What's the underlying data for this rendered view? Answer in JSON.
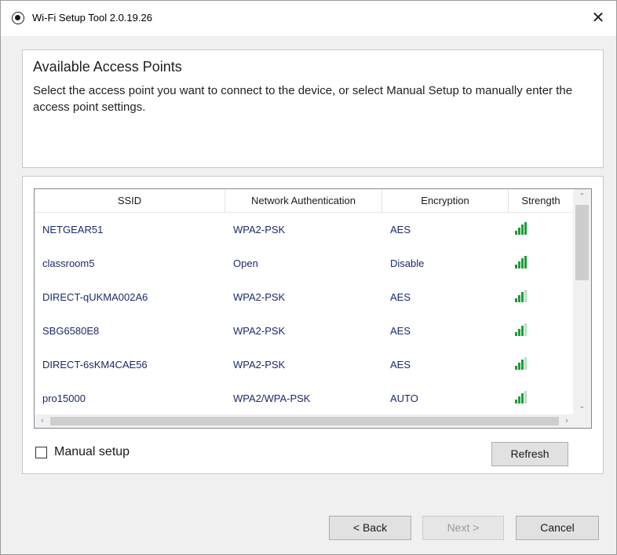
{
  "window": {
    "title": "Wi-Fi Setup Tool 2.0.19.26",
    "close_glyph": "✕"
  },
  "header": {
    "title": "Available Access Points",
    "description": "Select the access point you want to connect to the device, or select Manual Setup to manually enter the access point settings."
  },
  "table": {
    "columns": [
      "SSID",
      "Network Authentication",
      "Encryption",
      "Strength"
    ],
    "rows": [
      {
        "ssid": "NETGEAR51",
        "auth": "WPA2-PSK",
        "encryption": "AES",
        "strength_bars": 4
      },
      {
        "ssid": "classroom5",
        "auth": "Open",
        "encryption": "Disable",
        "strength_bars": 4
      },
      {
        "ssid": "DIRECT-qUKMA002A6",
        "auth": "WPA2-PSK",
        "encryption": "AES",
        "strength_bars": 3
      },
      {
        "ssid": "SBG6580E8",
        "auth": "WPA2-PSK",
        "encryption": "AES",
        "strength_bars": 3
      },
      {
        "ssid": "DIRECT-6sKM4CAE56",
        "auth": "WPA2-PSK",
        "encryption": "AES",
        "strength_bars": 3
      },
      {
        "ssid": "pro15000",
        "auth": "WPA2/WPA-PSK",
        "encryption": "AUTO",
        "strength_bars": 3
      }
    ],
    "signal_icon": "signal-strength-icon",
    "signal_on_color": "#1e9b3a",
    "signal_off_color": "#b9e0c2"
  },
  "manual_setup": {
    "label": "Manual setup",
    "checked": false
  },
  "buttons": {
    "refresh": "Refresh",
    "back": "< Back",
    "next": "Next >",
    "cancel": "Cancel"
  }
}
